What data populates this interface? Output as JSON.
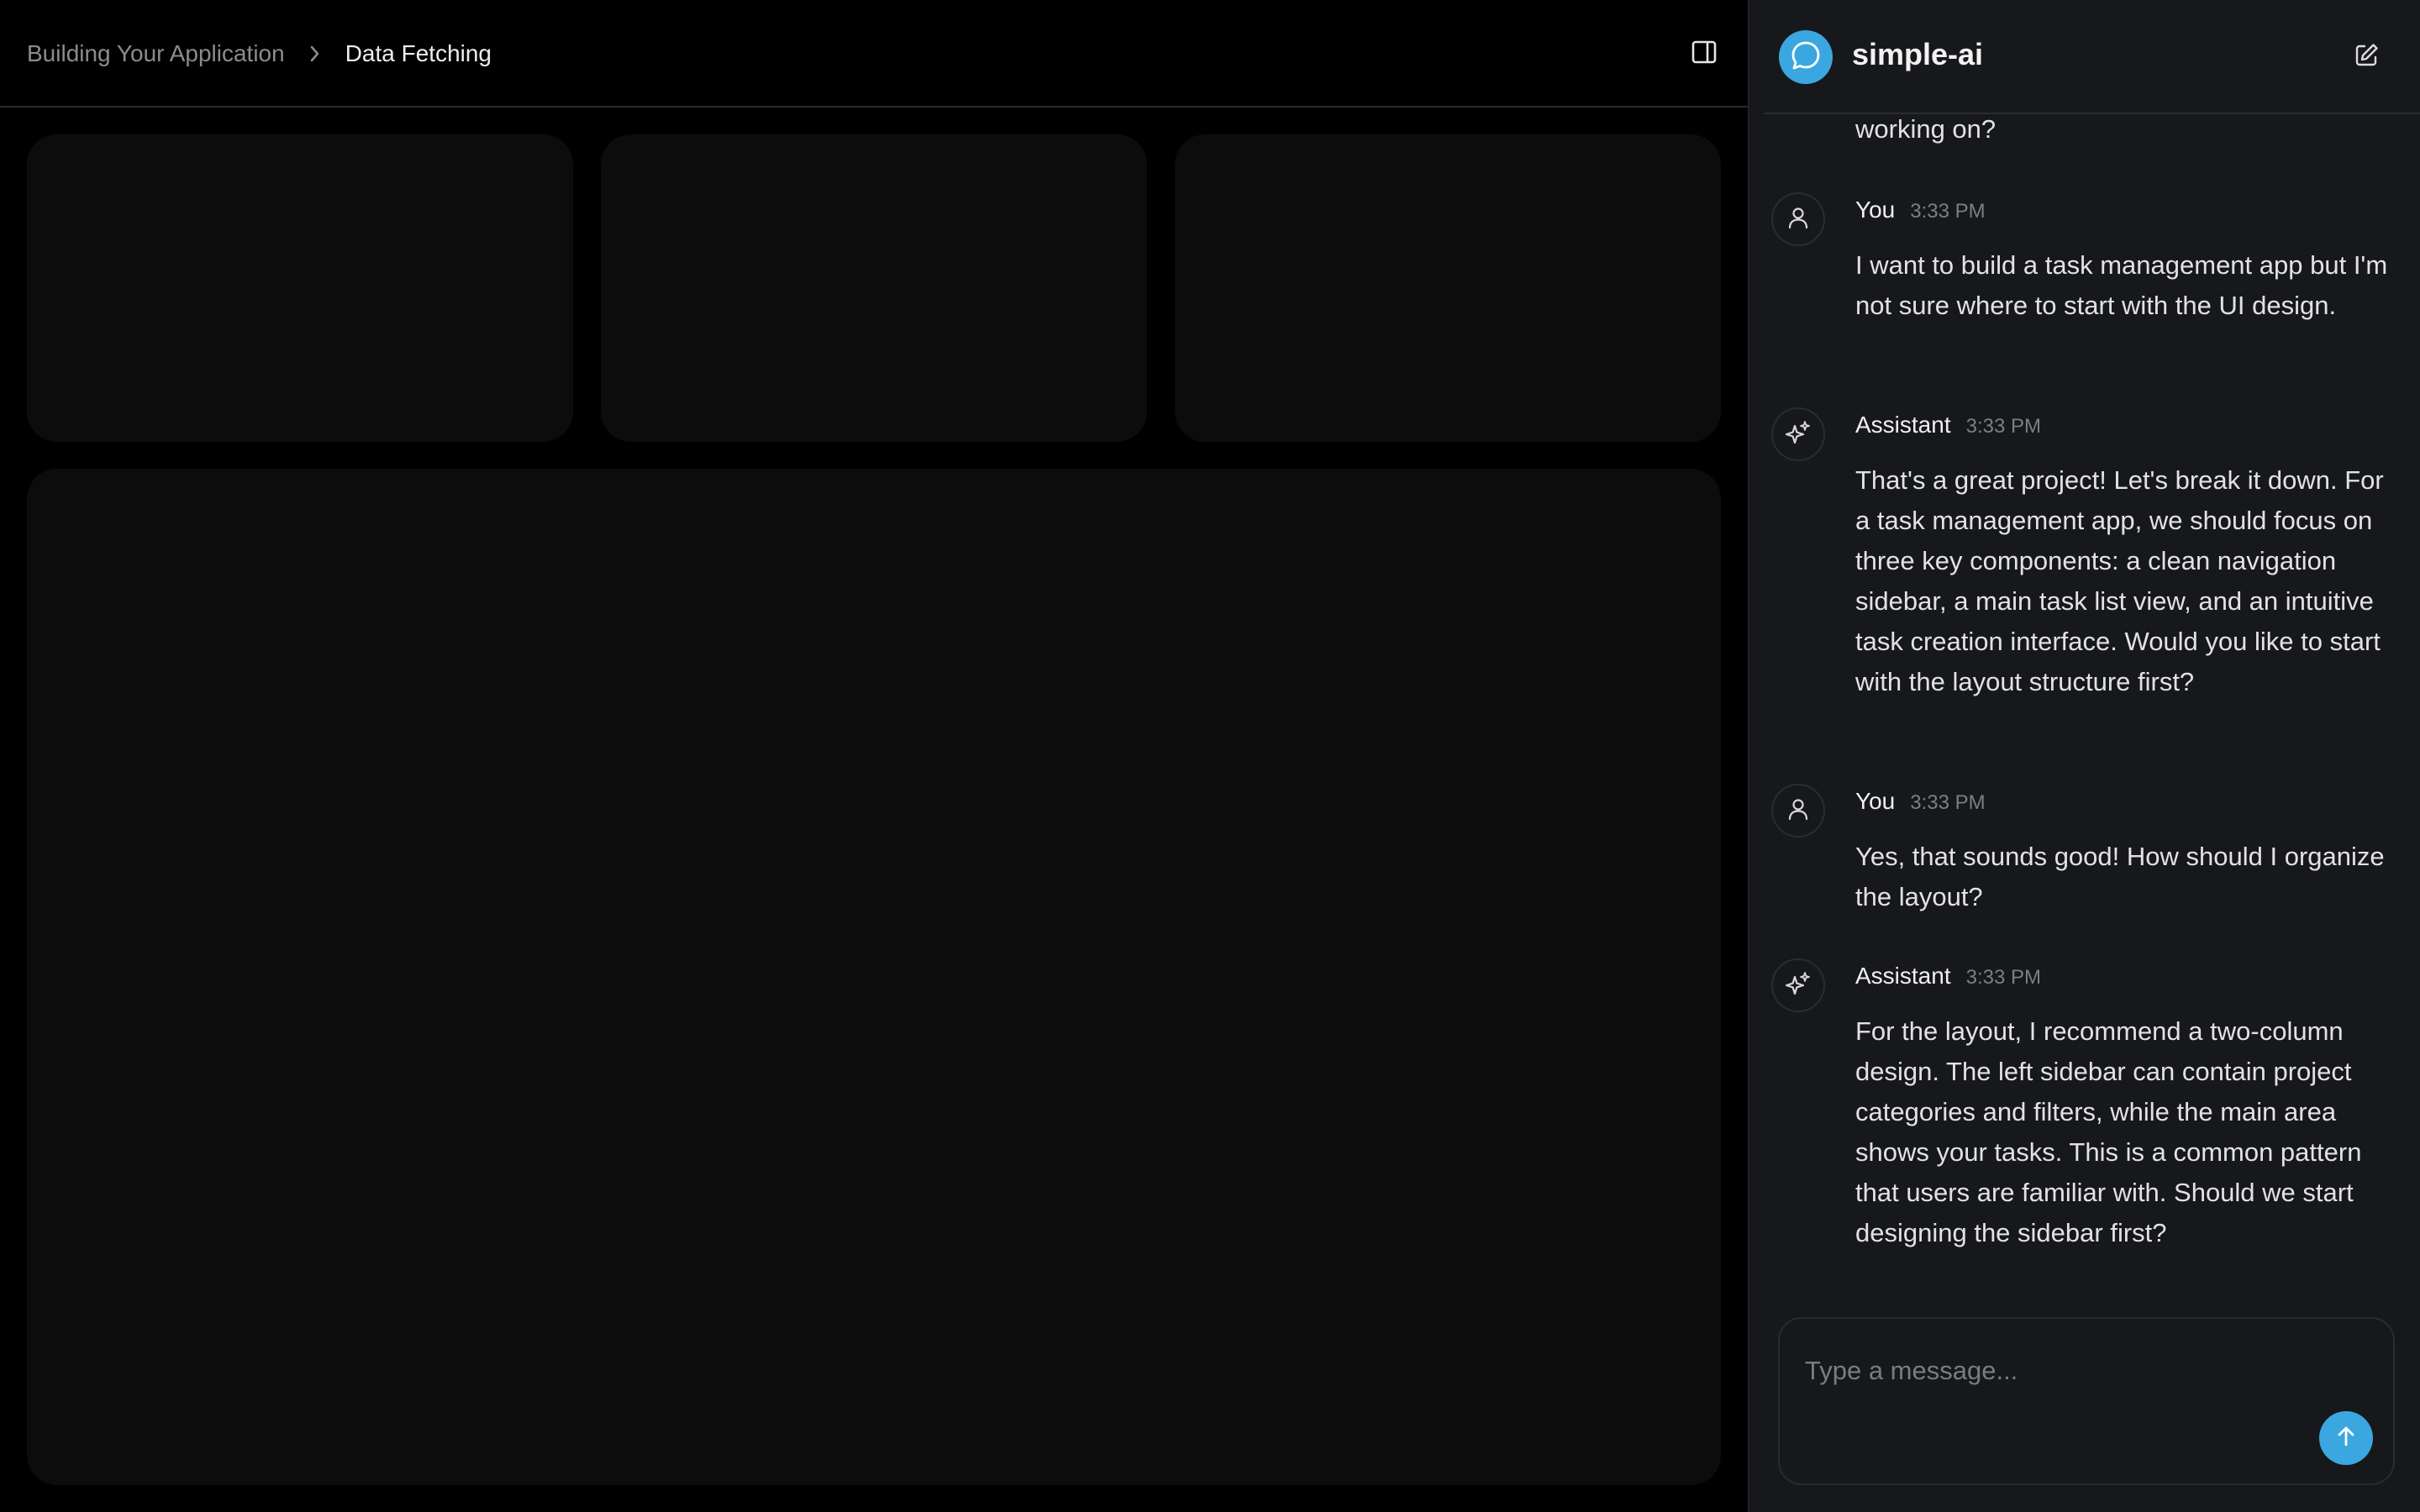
{
  "breadcrumb": {
    "parent": "Building Your Application",
    "current": "Data Fetching"
  },
  "icons": {
    "breadcrumb_separator": "chevron-right-icon",
    "sidebar_toggle": "panel-right-icon",
    "brand": "message-circle-icon",
    "new_chat": "edit-square-icon",
    "user_avatar": "user-icon",
    "assistant_avatar": "sparkles-icon",
    "send": "arrow-up-icon"
  },
  "chat": {
    "app_name": "simple-ai",
    "partial_message": "working on?",
    "messages": [
      {
        "role": "user",
        "author": "You",
        "time": "3:33 PM",
        "text": "I want to build a task management app but I'm not sure where to start with the UI design."
      },
      {
        "role": "assistant",
        "author": "Assistant",
        "time": "3:33 PM",
        "text": "That's a great project! Let's break it down. For a task management app, we should focus on three key components: a clean navigation sidebar, a main task list view, and an intuitive task creation interface. Would you like to start with the layout structure first?"
      },
      {
        "role": "user",
        "author": "You",
        "time": "3:33 PM",
        "text": "Yes, that sounds good! How should I organize the layout?"
      },
      {
        "role": "assistant",
        "author": "Assistant",
        "time": "3:33 PM",
        "text": "For the layout, I recommend a two-column design. The left sidebar can contain project categories and filters, while the main area shows your tasks. This is a common pattern that users are familiar with. Should we start designing the sidebar first?"
      }
    ],
    "composer": {
      "placeholder": "Type a message...",
      "value": ""
    }
  },
  "colors": {
    "accent": "#3ba7e0",
    "panel_bg": "#17181b",
    "card_bg": "#0c0c0c",
    "page_bg": "#000000"
  }
}
